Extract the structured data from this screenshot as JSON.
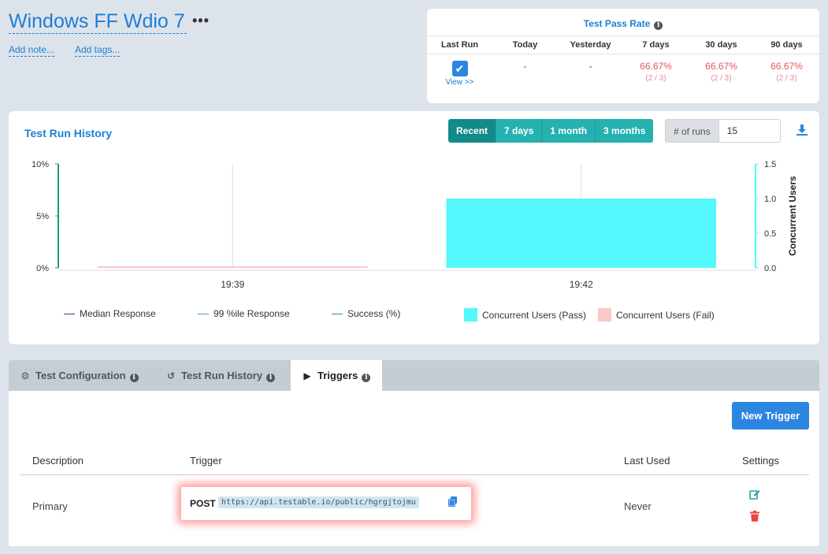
{
  "header": {
    "title": "Windows FF Wdio 7",
    "more": "•••",
    "add_note": "Add note...",
    "add_tags": "Add tags..."
  },
  "pass_rate": {
    "title": "Test Pass Rate",
    "columns": [
      "Last Run",
      "Today",
      "Yesterday",
      "7 days",
      "30 days",
      "90 days"
    ],
    "view_link": "View >>",
    "today": "-",
    "yesterday": "-",
    "d7": {
      "pct": "66.67%",
      "frac": "(2 / 3)"
    },
    "d30": {
      "pct": "66.67%",
      "frac": "(2 / 3)"
    },
    "d90": {
      "pct": "66.67%",
      "frac": "(2 / 3)"
    }
  },
  "history": {
    "title": "Test Run History",
    "ranges": [
      "Recent",
      "7 days",
      "1 month",
      "3 months"
    ],
    "active_range": "Recent",
    "runs_label": "# of runs",
    "runs_value": "15",
    "legend": {
      "median": "Median Response",
      "p99": "99 %ile Response",
      "success": "Success (%)",
      "pass": "Concurrent Users (Pass)",
      "fail": "Concurrent Users (Fail)"
    }
  },
  "chart_data": {
    "type": "bar",
    "categories": [
      "19:39",
      "19:42"
    ],
    "series": [
      {
        "name": "Concurrent Users (Pass)",
        "values": [
          0,
          1
        ],
        "color": "#54f7fb"
      },
      {
        "name": "Concurrent Users (Fail)",
        "values": [
          0,
          0
        ],
        "color": "#f9c8c8"
      }
    ],
    "ylabel": "",
    "y2label": "Concurrent Users",
    "y_left_ticks": [
      "10%",
      "5%",
      "0%"
    ],
    "y_right_ticks": [
      "1.5",
      "1.0",
      "0.5",
      "0.0"
    ],
    "ylim_left": [
      0,
      10
    ],
    "ylim_right": [
      0,
      1.5
    ],
    "colors": {
      "success_axis": "#1aa06d",
      "right_axis": "#54f7fb"
    }
  },
  "tabs": [
    {
      "label": "Test Configuration",
      "icon": "gear-icon"
    },
    {
      "label": "Test Run History",
      "icon": "history-icon"
    },
    {
      "label": "Triggers",
      "icon": "play-icon"
    }
  ],
  "triggers": {
    "new_button": "New Trigger",
    "headers": [
      "Description",
      "Trigger",
      "Last Used",
      "Settings"
    ],
    "rows": [
      {
        "description": "Primary",
        "method": "POST",
        "url": "https://api.testable.io/public/hgrgjtojmu",
        "last_used": "Never"
      }
    ]
  },
  "colors": {
    "accent": "#1a7fd6",
    "teal": "#26b1b1",
    "danger": "#e05b5b"
  }
}
